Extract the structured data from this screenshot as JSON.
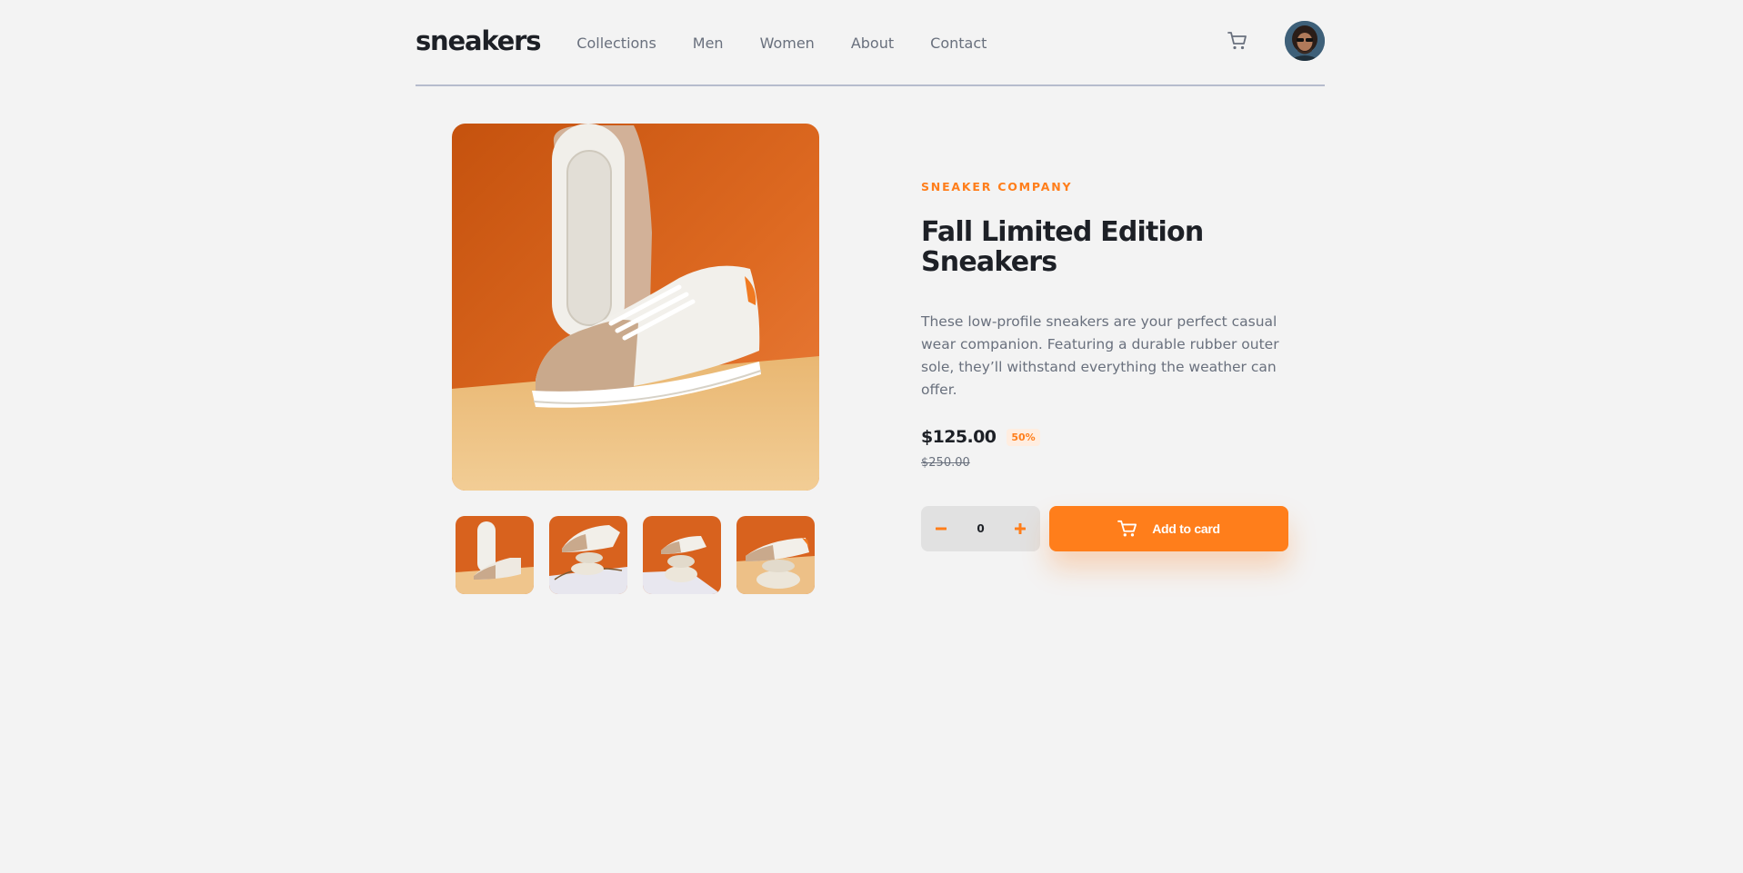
{
  "header": {
    "logo": "sneakers",
    "nav": [
      "Collections",
      "Men",
      "Women",
      "About",
      "Contact"
    ]
  },
  "product": {
    "company": "SNEAKER COMPANY",
    "title": "Fall Limited Edition Sneakers",
    "description": "These low-profile sneakers are your perfect casual wear companion. Featuring a durable rubber outer sole, they’ll withstand everything the weather can offer.",
    "price": "$125.00",
    "discount": "50%",
    "old_price": "$250.00",
    "quantity": "0",
    "add_label": "Add to card"
  },
  "colors": {
    "accent": "#ff7e1b",
    "accent_pale": "#ffede0",
    "text_dark": "#1d2026",
    "text_grey": "#69707d",
    "background": "#f3f3f3"
  }
}
